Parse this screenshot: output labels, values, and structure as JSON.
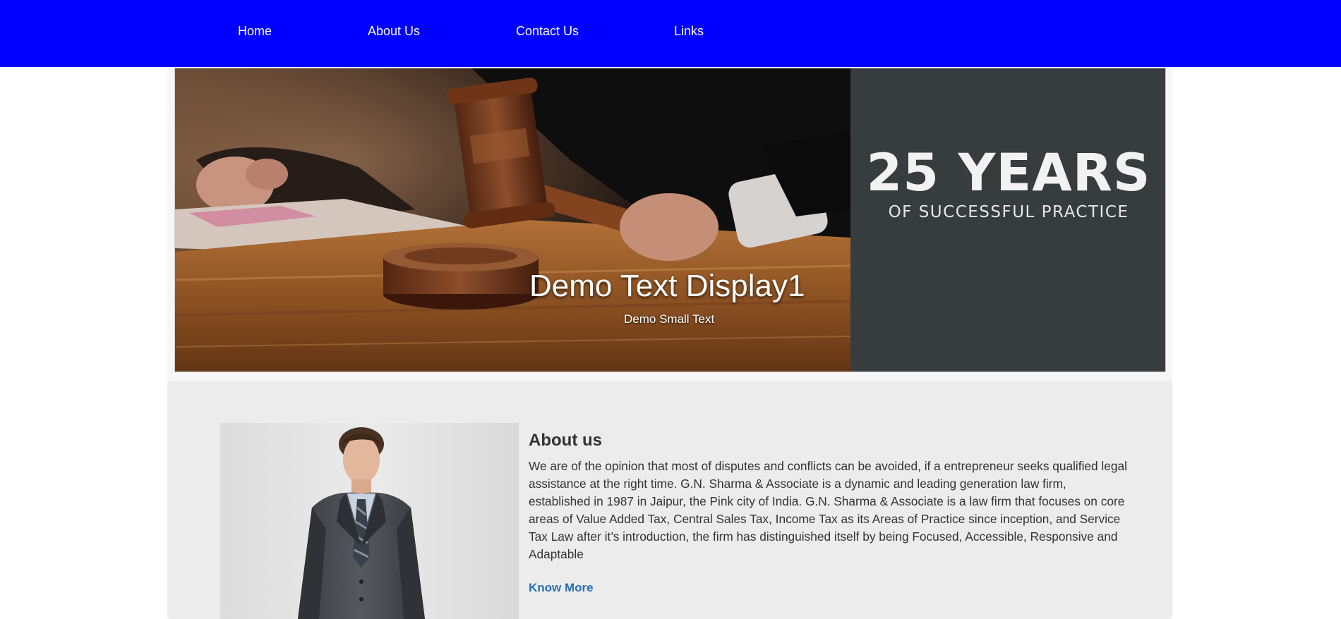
{
  "nav": {
    "links": [
      {
        "label": "Home"
      },
      {
        "label": "About Us"
      },
      {
        "label": "Contact Us"
      },
      {
        "label": "Links"
      }
    ]
  },
  "hero": {
    "years_big": "25 YEARS",
    "years_small": "OF SUCCESSFUL PRACTICE",
    "caption_title": "Demo Text Display1",
    "caption_subtitle": "Demo Small Text"
  },
  "about": {
    "heading": "About us",
    "body": "We are of the opinion that most of disputes and conflicts can be avoided, if a entrepreneur seeks qualified legal assistance at the right time. G.N. Sharma & Associate is a dynamic and leading generation law firm, established in 1987 in Jaipur, the Pink city of India. G.N. Sharma & Associate is a law firm that focuses on core areas of Value Added Tax, Central Sales Tax, Income Tax as its Areas of Practice since inception, and Service Tax Law after it’s introduction, the firm has distinguished itself by being Focused, Accessible, Responsive and Adaptable",
    "know_more": "Know More"
  },
  "colors": {
    "nav_bg": "#0000ff",
    "side_panel": "#373c3f",
    "link": "#2a6fb5"
  }
}
